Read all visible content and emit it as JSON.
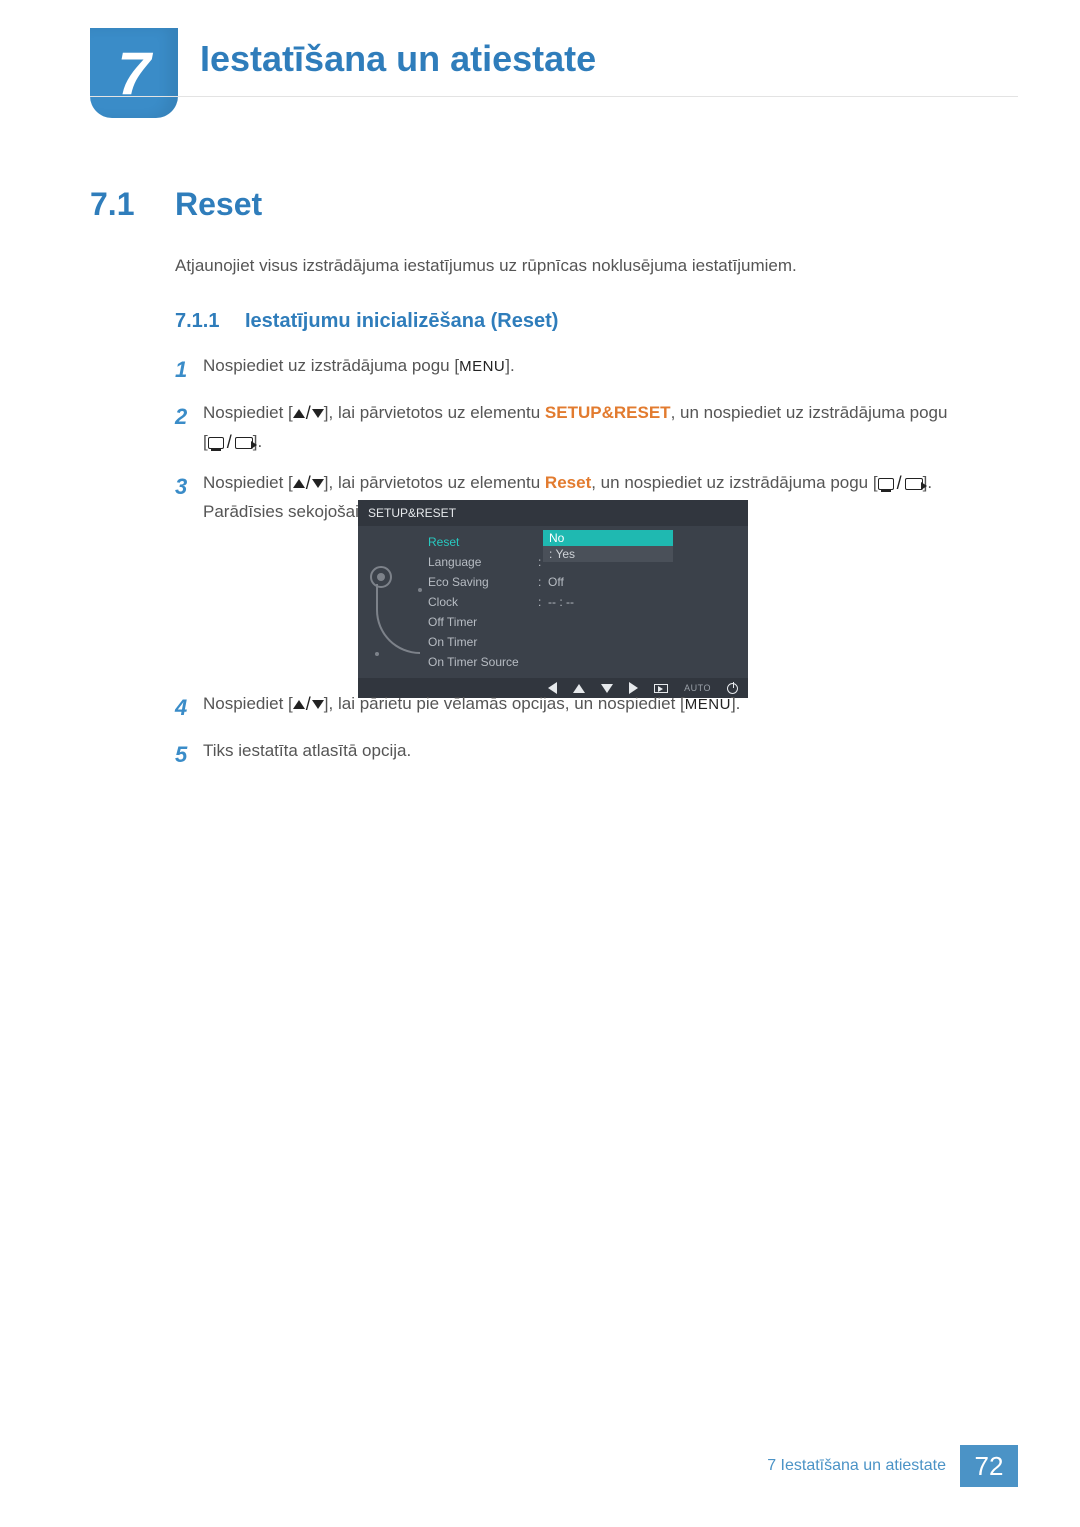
{
  "chapter": {
    "number": "7",
    "title": "Iestatīšana un atiestate"
  },
  "section": {
    "number": "7.1",
    "title": "Reset",
    "intro": "Atjaunojiet visus izstrādājuma iestatījumus uz rūpnīcas noklusējuma iestatījumiem."
  },
  "subsection": {
    "number": "7.1.1",
    "title": "Iestatījumu inicializēšana (Reset)"
  },
  "steps": {
    "s1": {
      "num": "1",
      "pre": "Nospiediet uz izstrādājuma pogu [",
      "menu": "MENU",
      "post": "]."
    },
    "s2": {
      "num": "2",
      "pre": "Nospiediet [",
      "mid1": "], lai pārvietotos uz elementu ",
      "kw": "SETUP&RESET",
      "mid2": ", un nospiediet uz izstrādājuma pogu",
      "post": "[",
      "end": "]."
    },
    "s3": {
      "num": "3",
      "pre": "Nospiediet [",
      "mid1": "], lai pārvietotos uz elementu ",
      "kw": "Reset",
      "mid2": ", un nospiediet uz izstrādājuma pogu [",
      "end": "].",
      "tail": "Parādīsies sekojošais ekrāns."
    },
    "s4": {
      "num": "4",
      "pre": "Nospiediet [",
      "mid": "], lai pārietu pie vēlamās opcijas, un nospiediet [",
      "menu": "MENU",
      "post": "]."
    },
    "s5": {
      "num": "5",
      "text": "Tiks iestatīta atlasītā opcija."
    }
  },
  "osd": {
    "title": "SETUP&RESET",
    "rows": [
      {
        "label": "Reset",
        "value": "",
        "highlight": true
      },
      {
        "label": "Language",
        "value": ""
      },
      {
        "label": "Eco Saving",
        "value": "Off"
      },
      {
        "label": "Clock",
        "value": "-- : --"
      },
      {
        "label": "Off Timer",
        "value": ""
      },
      {
        "label": "On Timer",
        "value": ""
      },
      {
        "label": "On Timer Source",
        "value": ""
      }
    ],
    "popup": {
      "no": "No",
      "yes": "Yes"
    },
    "footer_auto": "AUTO"
  },
  "footer": {
    "text": "7 Iestatīšana un atiestate",
    "page": "72"
  }
}
